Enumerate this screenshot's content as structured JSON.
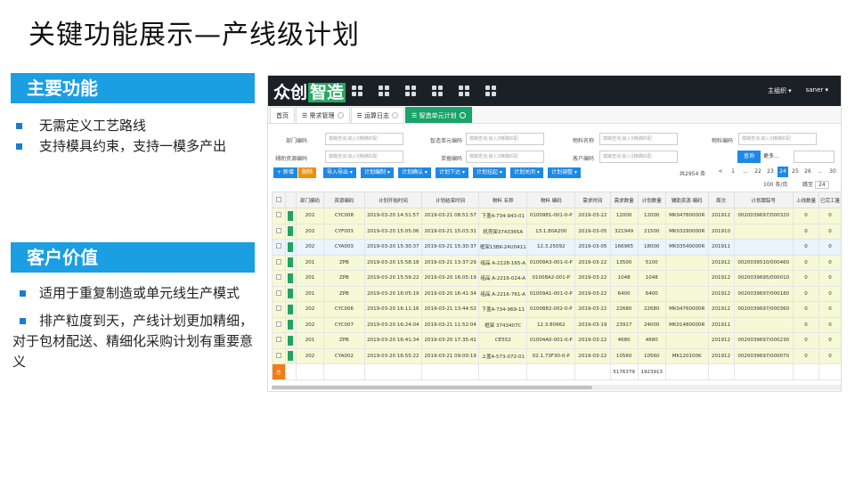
{
  "slide": {
    "title": "关键功能展示—产线级计划",
    "features_header": "主要功能",
    "features": [
      "无需定义工艺路线",
      "支持模具约束，支持一模多产出"
    ],
    "value_header": "客户价值",
    "values": [
      "适用于重复制造或单元线生产模式",
      "排产粒度到天，产线计划更加精细，对于包材配送、精细化采购计划有重要意义"
    ]
  },
  "app": {
    "logo": "众创",
    "logo_accent": "智造",
    "user_menu": "主组织 ▾",
    "user_name": "saner ▾",
    "tabs": [
      "首页",
      "需求管理",
      "运算日志",
      "智造单元计划"
    ],
    "filters": {
      "labels": [
        "部门编码",
        "智造单元编码",
        "物料名称",
        "物料编码",
        "辅助资源编码",
        "单据编码",
        "客户编码"
      ],
      "placeholder": "模糊查询,输入5精确匹配",
      "query": "查询",
      "more": "更多..."
    },
    "toolbar": {
      "add": "+ 新增",
      "delete": "删除",
      "buttons": [
        "导入导出 ▾",
        "计划编制 ▾",
        "计划确认 ▾",
        "计划下达 ▾",
        "计划挂起 ▾",
        "计划关闭 ▾",
        "计划调整 ▾"
      ],
      "total": "共2954 条",
      "pages": [
        "<",
        "1",
        "...",
        "22",
        "23",
        "24",
        "25",
        "26",
        "...",
        "30",
        ">"
      ],
      "per_page": "100 条/页",
      "jump_label": "跳至",
      "jump_value": "24"
    },
    "columns": [
      "部门编码",
      "资源编码",
      "计划开始时间",
      "计划结束时间",
      "物料 名称",
      "物料 编码",
      "需求时间",
      "需求数量",
      "计划数量",
      "辅助资源 编码",
      "周次",
      "计划跟踪号",
      "上线数量",
      "已完工量"
    ],
    "rows": [
      [
        "202",
        "CYC008",
        "2019-03-20 14:51:57",
        "2019-03-21 08:51:57",
        "下盖4-734-943-01",
        "0100981-001-0-P",
        "2019-03-22",
        "12000",
        "12000",
        "MK04780000R",
        "201912",
        "0020039697/000320",
        "0",
        "0"
      ],
      [
        "202",
        "CYF003",
        "2019-03-20 15:05:06",
        "2019-03-21 15:03:31",
        "机壳架3743365A",
        "13.1.80A200",
        "2019-03-05",
        "321949",
        "21500",
        "MK03290000R",
        "201910",
        "",
        "0",
        "0"
      ],
      [
        "202",
        "CYA003",
        "2019-03-20 15:30:37",
        "2019-03-21 15:30:37",
        "框架13BK-24U0411",
        "12.3.25092",
        "2019-03-05",
        "166965",
        "18000",
        "MK03540000R",
        "201911",
        "",
        "0",
        "0"
      ],
      [
        "201",
        "ZPB",
        "2019-03-20 15:58:18",
        "2019-03-21 13:37:29",
        "组品 A-2228-165-A",
        "01009A3-001-0-P",
        "2019-03-22",
        "13500",
        "5100",
        "",
        "201912",
        "0020039510/000460",
        "0",
        "0"
      ],
      [
        "201",
        "ZPB",
        "2019-03-20 15:59:22",
        "2019-03-20 16:05:19",
        "组品 A-2216-024-A",
        "01008A2-001-P",
        "2019-03-22",
        "1048",
        "1048",
        "",
        "201912",
        "0020039695/000010",
        "0",
        "0"
      ],
      [
        "201",
        "ZPB",
        "2019-03-20 16:05:19",
        "2019-03-20 16:41:34",
        "组品 A-2216-761-A",
        "01009A1-001-0-P",
        "2019-03-22",
        "6400",
        "6400",
        "",
        "201912",
        "0020039697/000180",
        "0",
        "0"
      ],
      [
        "202",
        "CYC006",
        "2019-03-20 16:11:16",
        "2019-03-21 13:44:52",
        "下盖4-734-969-11",
        "0100882-002-0-P",
        "2019-03-22",
        "22680",
        "22680",
        "MK04760000R",
        "201912",
        "0020039697/000360",
        "0",
        "0"
      ],
      [
        "202",
        "CYC007",
        "2019-03-20 16:24:04",
        "2019-03-21 11:52:04",
        "框架 3743407C",
        "12.3.80962",
        "2019-03-19",
        "23917",
        "24000",
        "MK01480000R",
        "201911",
        "",
        "0",
        "0"
      ],
      [
        "201",
        "ZPB",
        "2019-03-20 16:41:34",
        "2019-03-20 17:35:41",
        "CE552",
        "01004A0-001-0-P",
        "2019-03-22",
        "4680",
        "4680",
        "",
        "201912",
        "0020039697/000230",
        "0",
        "0"
      ],
      [
        "202",
        "CYA002",
        "2019-03-20 16:55:22",
        "2019-03-21 09:00:19",
        "上盖4-573-072-01",
        "02.1.73F30-0-P",
        "2019-03-22",
        "10560",
        "10560",
        "MK120100K",
        "201912",
        "0020039697/000070",
        "0",
        "0"
      ]
    ],
    "totals": {
      "label": "总",
      "demand": "5176379",
      "planned": "1923913"
    }
  },
  "colors": {
    "accent": "#1b9ee2",
    "active_tab": "#1aa36b",
    "primary_button": "#1e88e5",
    "orange": "#f0900c"
  }
}
